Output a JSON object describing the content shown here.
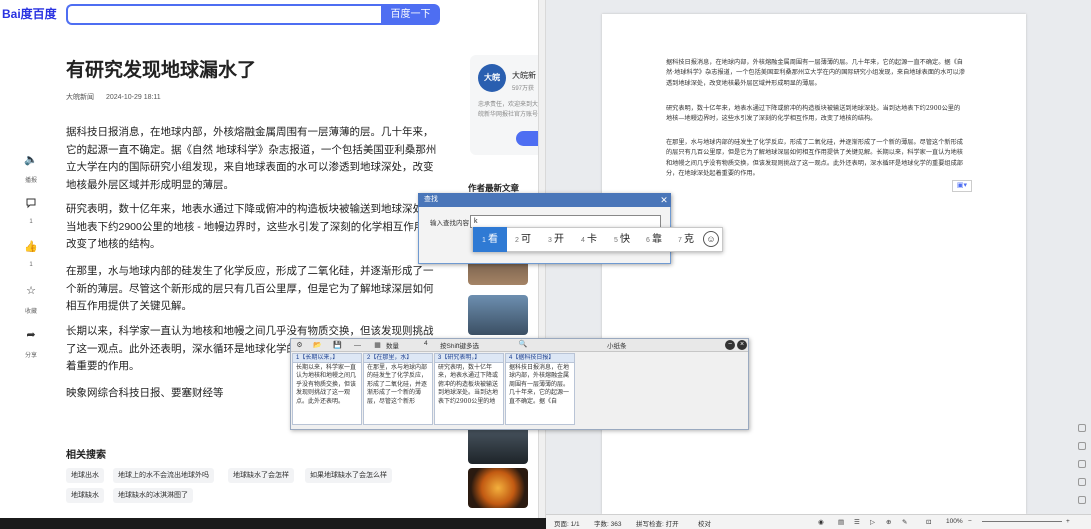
{
  "browser": {
    "logo": "Bai度百度",
    "search_button": "百度一下",
    "rail": [
      {
        "icon": "speaker-icon",
        "label": "播报"
      },
      {
        "icon": "comment-icon",
        "label": "1"
      },
      {
        "icon": "like-icon",
        "label": "1"
      },
      {
        "icon": "star-icon",
        "label": "收藏"
      },
      {
        "icon": "share-icon",
        "label": "分享"
      }
    ],
    "article": {
      "title": "有研究发现地球漏水了",
      "source": "大皖新闻",
      "date": "2024-10-29 18:11",
      "paragraphs": [
        "据科技日报消息，在地球内部，外核熔融金属周围有一层薄薄的层。几十年来，它的起源一直不确定。据《自然 地球科学》杂志报道，一个包括美国亚利桑那州立大学在内的国际研究小组发现，来自地球表面的水可以渗透到地球深处，改变地核最外层区域并形成明显的薄层。",
        "研究表明，数十亿年来，地表水通过下降或俯冲的构造板块被输送到地球深处。当地表下约2900公里的地核 - 地幔边界时，这些水引发了深刻的化学相互作用，改变了地核的结构。",
        "在那里，水与地球内部的硅发生了化学反应，形成了二氧化硅，并逐渐形成了一个新的薄层。尽管这个新形成的层只有几百公里厚，但是它为了解地球深层如何相互作用提供了关键见解。",
        "长期以来，科学家一直认为地核和地幔之间几乎没有物质交换，但该发现则挑战了这一观点。此外还表明，深水循环是地球化学的重要组成部分，在地球深处起着重要的作用。",
        "映象网综合科技日报、要塞财经等"
      ]
    },
    "related": {
      "title": "相关搜索",
      "tags": [
        "地球出水",
        "地球上的水不会流出地球外吗",
        "地球缺水了会怎样",
        "如果地球缺水了会怎么样",
        "地球缺水",
        "地球缺水的冰淇淋图了"
      ]
    },
    "author": {
      "avatar_text": "大皖",
      "name": "大皖新",
      "fans": "597万获",
      "desc": "忠承责任，欢迎来到大皖新华网报社官方账号"
    },
    "latest_title": "作者最新文章"
  },
  "word": {
    "paragraphs": [
      "据科技日报消息，在地球内部，外核熔融金属周围有一层薄薄的层。几十年来，它的起源一直不确定。据《自然·地球科学》杂志报道，一个包括美国亚利桑那州立大学在内的国际研究小组发现，来自地球表面的水可以渗透到地球深处，改变地核最外层区域并形成明显的薄层。",
      "研究表明，数十亿年来，地表水通过下降或俯冲的构造板块被输送到地球深处。当到达地表下约2900公里的地核—地幔边界时，这些水引发了深刻的化学相互作用，改变了地核的结构。",
      "在那里，水与地球内部的硅发生了化学反应，形成了二氧化硅，并逐渐形成了一个新的薄层。尽管这个新形成的层只有几百公里厚，但是它为了解地球深层如何相互作用提供了关键见解。长期以来，科学家一直认为地核和地幔之间几乎没有物质交换，但该发现则挑战了这一观点。此外还表明，深水循环是地球化学的重要组成部分，在地球深处起着重要的作用。"
    ],
    "status": {
      "page": "页面: 1/1",
      "words": "字数: 363",
      "spell": "拼写检查: 打开",
      "proof": "校对",
      "zoom": "100%"
    }
  },
  "find_dialog": {
    "title": "查找",
    "label": "输入查找内容",
    "value": "k"
  },
  "ime": {
    "candidates": [
      {
        "n": "1",
        "t": "看"
      },
      {
        "n": "2",
        "t": "可"
      },
      {
        "n": "3",
        "t": "开"
      },
      {
        "n": "4",
        "t": "卡"
      },
      {
        "n": "5",
        "t": "快"
      },
      {
        "n": "6",
        "t": "靠"
      },
      {
        "n": "7",
        "t": "克"
      }
    ],
    "selected": 0
  },
  "notes": {
    "mode": "数量",
    "count": "4",
    "filter": "按Shift键多选",
    "name": "小纸条",
    "cards": [
      {
        "head": "1【长期以来，】",
        "body": "长期以来，科学家一直认为地核和地幔之间几乎没有物质交换，但该发现则挑战了这一观点。此外还表明。"
      },
      {
        "head": "2【在那里，水】",
        "body": "在那里，水与地球内部的硅发生了化学反应，形成了二氧化硅，并逐渐形成了一个新的薄层，尽管这个新形"
      },
      {
        "head": "3【研究表明，】",
        "body": "研究表明，数十亿年来，地表水通过下降或俯冲的构造板块被输送到地球深处。当到达地表下约2900公里的地"
      },
      {
        "head": "4【据科技日报】",
        "body": "据科技日报消息，在地球内部，外核熔融金属周围有一层薄薄的层。几十年来，它的起源一直不确定。据《自"
      }
    ]
  }
}
